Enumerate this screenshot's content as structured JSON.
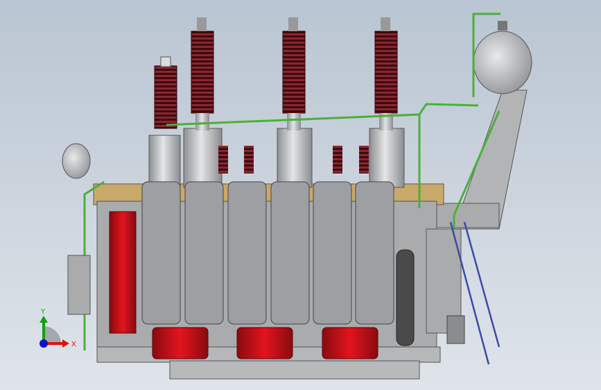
{
  "viewport": {
    "model": "power-transformer-3d-model",
    "colors": {
      "background_top": "#b9c5d2",
      "background_bottom": "#dfe4ea",
      "tank": "#a9abad",
      "radiator": "#9d9fa2",
      "fan": "#d0121b",
      "bushing_insulator": "#6a1a22",
      "pipe": "#4caf3a",
      "filter_column": "#c4281c",
      "gas_cylinder": "#4a4a4a",
      "ladder": "#3b4aa8"
    }
  },
  "triad": {
    "x_label": "X",
    "y_label": "Y",
    "x_color": "#e01010",
    "y_color": "#10a010",
    "z_color": "#1010d0"
  }
}
